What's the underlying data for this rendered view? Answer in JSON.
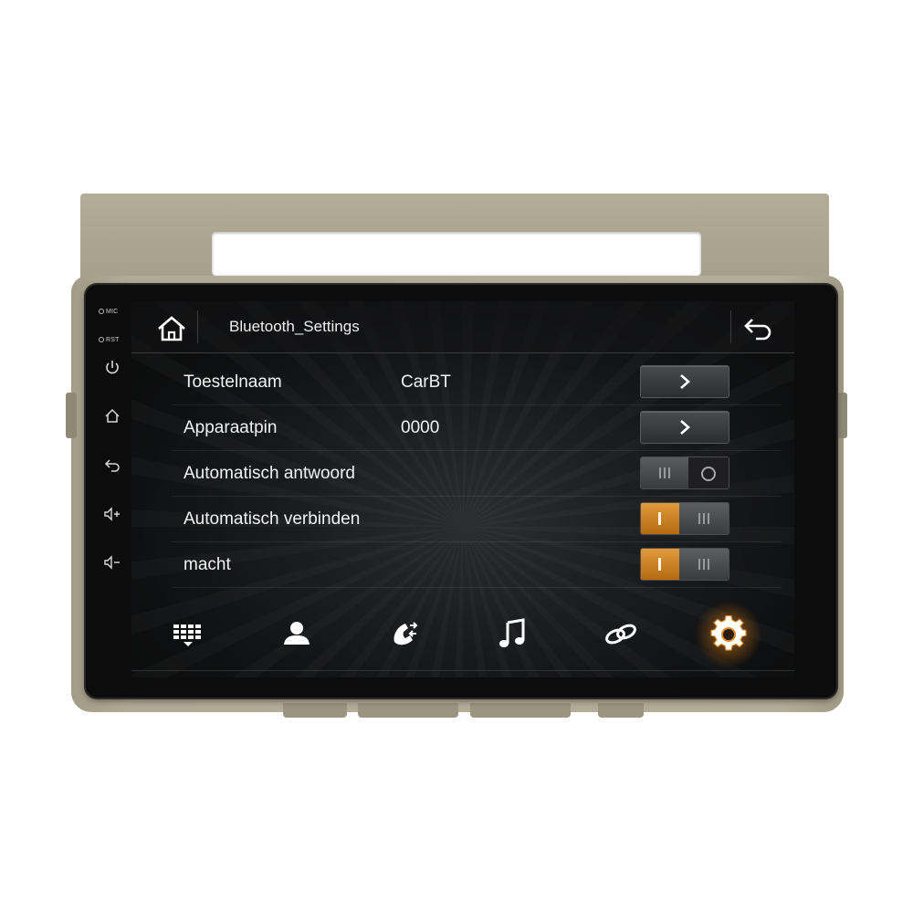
{
  "hardkeys": {
    "mic_label": "MIC",
    "rst_label": "RST",
    "icons": [
      "power-icon",
      "home-icon",
      "back-icon",
      "volume-up-icon",
      "volume-down-icon"
    ]
  },
  "header": {
    "title": "Bluetooth_Settings",
    "home_icon": "home-icon",
    "back_icon": "return-icon"
  },
  "settings": [
    {
      "label": "Toestelnaam",
      "value": "CarBT",
      "control": "arrow"
    },
    {
      "label": "Apparaatpin",
      "value": "0000",
      "control": "arrow"
    },
    {
      "label": "Automatisch antwoord",
      "value": "",
      "control": "toggle",
      "state": "off"
    },
    {
      "label": "Automatisch verbinden",
      "value": "",
      "control": "toggle",
      "state": "on"
    },
    {
      "label": "macht",
      "value": "",
      "control": "toggle",
      "state": "on"
    }
  ],
  "dock": {
    "items": [
      "dialpad-icon",
      "contacts-icon",
      "call-log-icon",
      "music-icon",
      "link-icon",
      "settings-icon"
    ],
    "active": "settings-icon"
  },
  "colors": {
    "accent": "#d9892a",
    "text": "#f2f2f2",
    "bezel": "#aea792"
  }
}
